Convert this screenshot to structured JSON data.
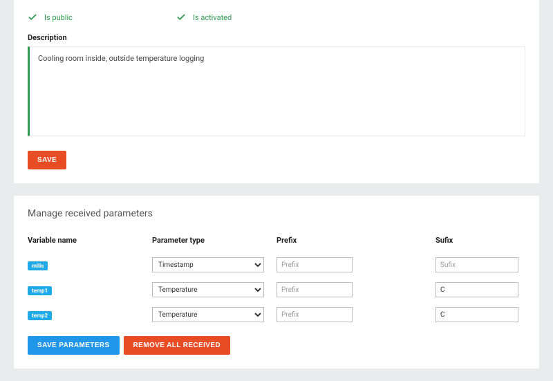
{
  "top": {
    "is_public_label": "Is public",
    "is_activated_label": "Is activated",
    "description_label": "Description",
    "description_value": "Cooling room inside, outside temperature logging",
    "save_label": "SAVE"
  },
  "params": {
    "section_title": "Manage received parameters",
    "headers": {
      "variable": "Variable name",
      "type": "Parameter type",
      "prefix": "Prefix",
      "sufix": "Sufix"
    },
    "rows": [
      {
        "var": "milis",
        "type": "Timestamp",
        "prefix": "",
        "sufix": ""
      },
      {
        "var": "temp1",
        "type": "Temperature",
        "prefix": "",
        "sufix": "C"
      },
      {
        "var": "temp2",
        "type": "Temperature",
        "prefix": "",
        "sufix": "C"
      }
    ],
    "type_options": [
      "Timestamp",
      "Temperature"
    ],
    "prefix_placeholder": "Prefix",
    "sufix_placeholder": "Sufix",
    "save_params_label": "SAVE PARAMETERS",
    "remove_all_label": "REMOVE ALL RECEIVED"
  },
  "colors": {
    "green": "#2d9b4f",
    "orange": "#e74c25",
    "blue": "#2196e8",
    "tag_blue": "#1fa9e6"
  }
}
